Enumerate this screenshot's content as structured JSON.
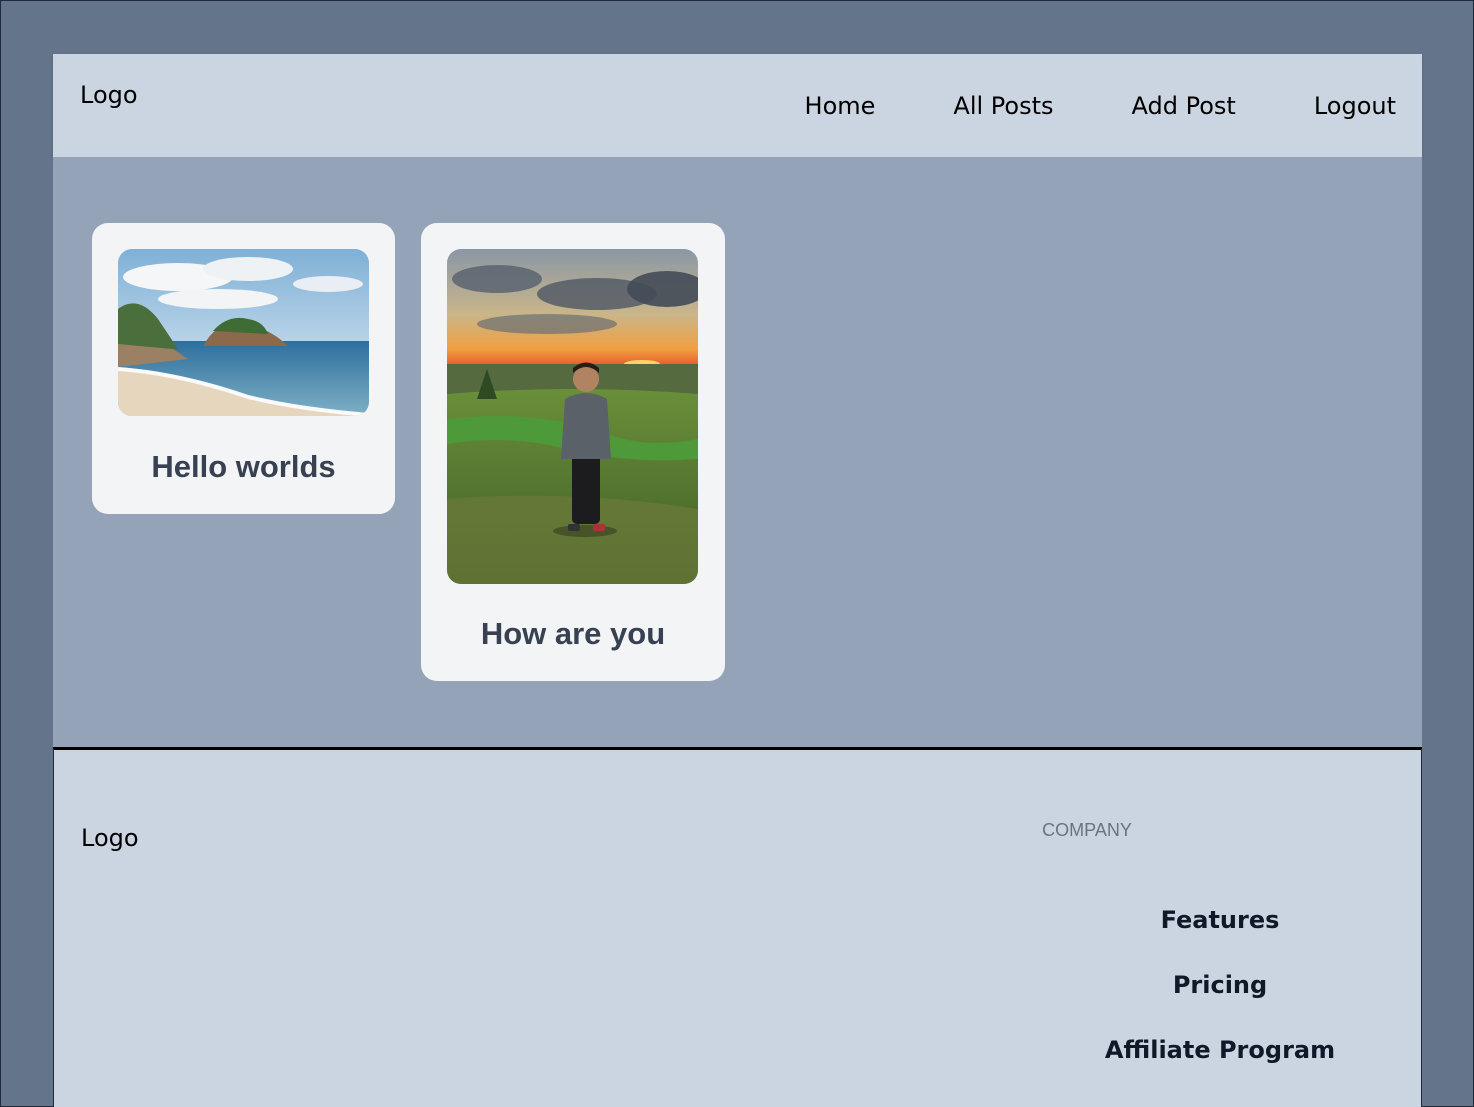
{
  "header": {
    "logo": "Logo",
    "nav": [
      "Home",
      "All Posts",
      "Add Post",
      "Logout"
    ]
  },
  "posts": [
    {
      "title": "Hello worlds",
      "image": "beach-landscape-image"
    },
    {
      "title": "How are you",
      "image": "person-at-sunset-image"
    }
  ],
  "footer": {
    "logo": "Logo",
    "company_heading": "Company",
    "links": [
      "Features",
      "Pricing",
      "Affiliate Program"
    ]
  },
  "colors": {
    "background": "#64748b",
    "header_bg": "#cbd5e1",
    "main_bg": "#94a3b8",
    "card_bg": "#f3f4f6",
    "footer_bg": "#cbd5e1"
  }
}
